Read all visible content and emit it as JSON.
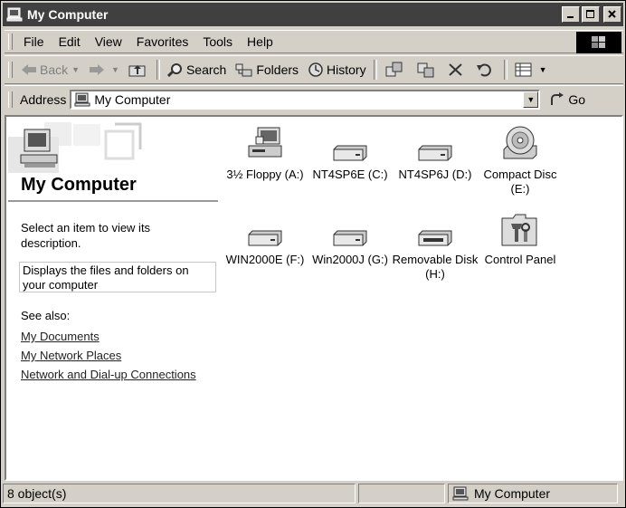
{
  "window": {
    "title": "My Computer"
  },
  "menu": [
    "File",
    "Edit",
    "View",
    "Favorites",
    "Tools",
    "Help"
  ],
  "toolbar": {
    "back": "Back",
    "search": "Search",
    "folders": "Folders",
    "history": "History"
  },
  "address": {
    "label": "Address",
    "value": "My Computer",
    "go": "Go"
  },
  "left_pane": {
    "title": "My Computer",
    "prompt": "Select an item to view its description.",
    "description": "Displays the files and folders on your computer",
    "see_also": "See also:",
    "links": [
      "My Documents",
      "My Network Places",
      "Network and Dial-up Connections"
    ]
  },
  "items": [
    {
      "label": "3½ Floppy (A:)",
      "icon": "floppy-drive-icon"
    },
    {
      "label": "NT4SP6E (C:)",
      "icon": "hard-drive-icon"
    },
    {
      "label": "NT4SP6J (D:)",
      "icon": "hard-drive-icon"
    },
    {
      "label": "Compact Disc (E:)",
      "icon": "cd-drive-icon"
    },
    {
      "label": "WIN2000E (F:)",
      "icon": "hard-drive-icon"
    },
    {
      "label": "Win2000J (G:)",
      "icon": "hard-drive-icon"
    },
    {
      "label": "Removable Disk (H:)",
      "icon": "removable-disk-icon"
    },
    {
      "label": "Control Panel",
      "icon": "control-panel-icon"
    }
  ],
  "status": {
    "count": "8 object(s)",
    "zone": "My Computer"
  }
}
